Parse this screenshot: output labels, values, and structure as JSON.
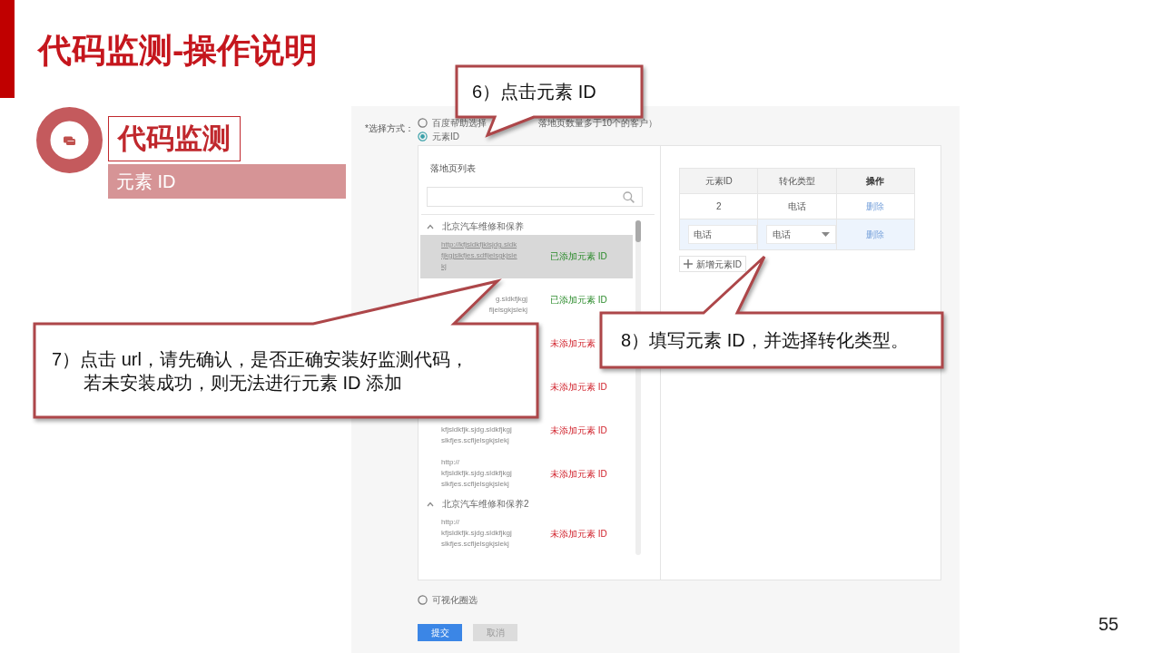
{
  "slide": {
    "title": "代码监测-操作说明",
    "section_title": "代码监测",
    "section_subtitle": "元素 ID",
    "page_number": "55"
  },
  "form": {
    "method_label": "*选择方式：",
    "methods": [
      {
        "label": "百度帮助选择",
        "label_tail": "落地页数量多于10个的客户）",
        "selected": false
      },
      {
        "label": "元素ID",
        "selected": true
      },
      {
        "label": "可视化圈选",
        "selected": false
      }
    ],
    "list_title": "落地页列表",
    "groups": [
      {
        "name": "北京汽车维修和保养",
        "expanded": true,
        "rows": [
          {
            "url": "http://kfjsldkfjklsjdg.sldk\nfjkgjslkfjes.sdfljelsgkjsle\nkj",
            "status": "已添加元素 ID",
            "added": true,
            "selected": true
          },
          {
            "url": "g.sldkfjkgj\nfljelsgkjslekj",
            "clipped_left": true,
            "status": "已添加元素 ID",
            "added": true,
            "selected": false
          },
          {
            "status": "未添加元素",
            "added": false,
            "selected": false
          },
          {
            "status": "未添加元素 ID",
            "added": false,
            "selected": false
          },
          {
            "url": "kfjsldkfjk.sjdg.sldkfjkgj\nslkfjes.scfljelsgkjslekj",
            "status": "未添加元素 ID",
            "added": false,
            "selected": false
          },
          {
            "url": "http://\nkfjsldkfjk.sjdg.sldkfjkgj\nslkfjes.scfljelsgkjslekj",
            "status": "未添加元素 ID",
            "added": false,
            "selected": false
          }
        ]
      },
      {
        "name": "北京汽车维修和保养2",
        "expanded": true,
        "rows": [
          {
            "url": "http://\nkfjsldkfjk.sjdg.sldkfjkgj\nslkfjes.scfljelsgkjslekj",
            "status": "未添加元素 ID",
            "added": false,
            "selected": false
          }
        ]
      }
    ],
    "table": {
      "columns": [
        "元素ID",
        "转化类型",
        "操作"
      ],
      "rows": [
        {
          "kind": "static",
          "element_id": "2",
          "conversion_type": "电话",
          "action": "删除"
        },
        {
          "kind": "editing",
          "element_id": "电话",
          "conversion_type": "电话",
          "action": "删除"
        }
      ]
    },
    "add_button": "新增元素ID",
    "buttons": [
      {
        "label": "提交",
        "kind": "primary"
      },
      {
        "label": "取消",
        "kind": "secondary"
      }
    ]
  },
  "callouts": [
    {
      "lines": [
        "6）点击元素 ID"
      ]
    },
    {
      "lines": [
        "7）点击 url，请先确认，是否正确安装好监测代码，",
        "若未安装成功，则无法进行元素 ID 添加"
      ]
    },
    {
      "lines": [
        "8）填写元素 ID，并选择转化类型。"
      ]
    }
  ]
}
